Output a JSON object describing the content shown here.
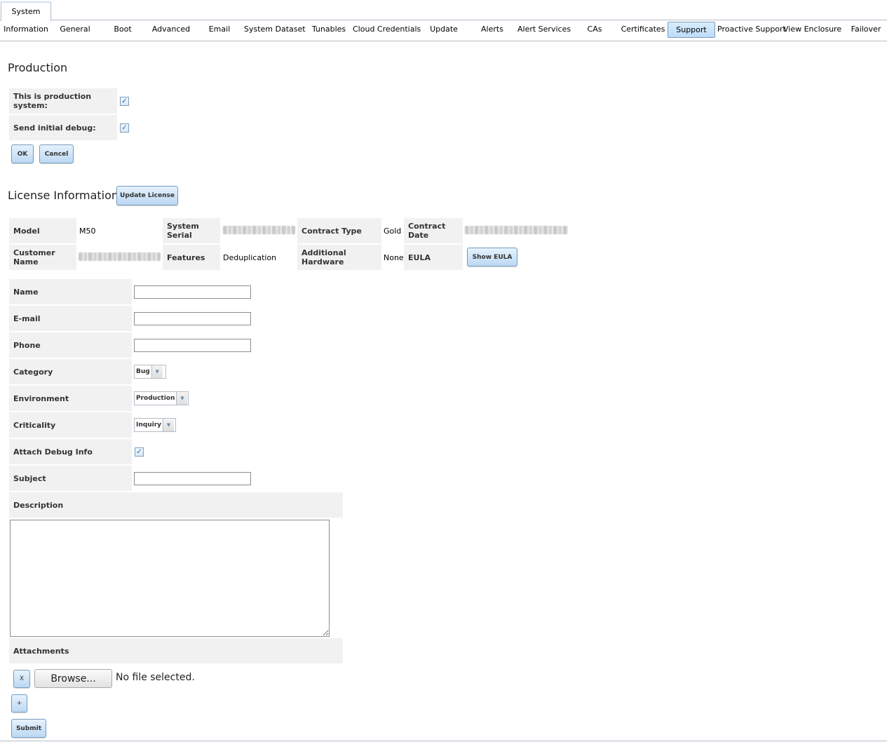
{
  "top_tab": "System",
  "subtabs": [
    "Information",
    "General",
    "Boot",
    "Advanced",
    "Email",
    "System Dataset",
    "Tunables",
    "Cloud Credentials",
    "Update",
    "Alerts",
    "Alert Services",
    "CAs",
    "Certificates",
    "Support",
    "Proactive Support",
    "View Enclosure",
    "Failover"
  ],
  "active_subtab": "Support",
  "production": {
    "title": "Production",
    "production_label": "This is production system:",
    "production_checked": true,
    "debug_label": "Send initial debug:",
    "debug_checked": true,
    "ok": "OK",
    "cancel": "Cancel"
  },
  "license": {
    "title": "License Information",
    "update_button": "Update License",
    "model_label": "Model",
    "model": "M50",
    "serial_label": "System Serial",
    "contract_type_label": "Contract Type",
    "contract_type": "Gold",
    "contract_date_label": "Contract Date",
    "customer_label": "Customer Name",
    "features_label": "Features",
    "features": "Deduplication",
    "hardware_label": "Additional Hardware",
    "hardware": "None",
    "eula_label": "EULA",
    "eula_button": "Show EULA"
  },
  "form": {
    "name_label": "Name",
    "name": "",
    "email_label": "E-mail",
    "email": "",
    "phone_label": "Phone",
    "phone": "",
    "category_label": "Category",
    "category": "Bug",
    "environment_label": "Environment",
    "environment": "Production",
    "criticality_label": "Criticality",
    "criticality": "Inquiry",
    "attach_label": "Attach Debug Info",
    "attach_checked": true,
    "subject_label": "Subject",
    "subject": "",
    "description_label": "Description",
    "description": "",
    "attachments_label": "Attachments",
    "remove_button": "X",
    "browse_button": "Browse...",
    "no_file": "No file selected.",
    "add_button": "+",
    "submit": "Submit"
  }
}
